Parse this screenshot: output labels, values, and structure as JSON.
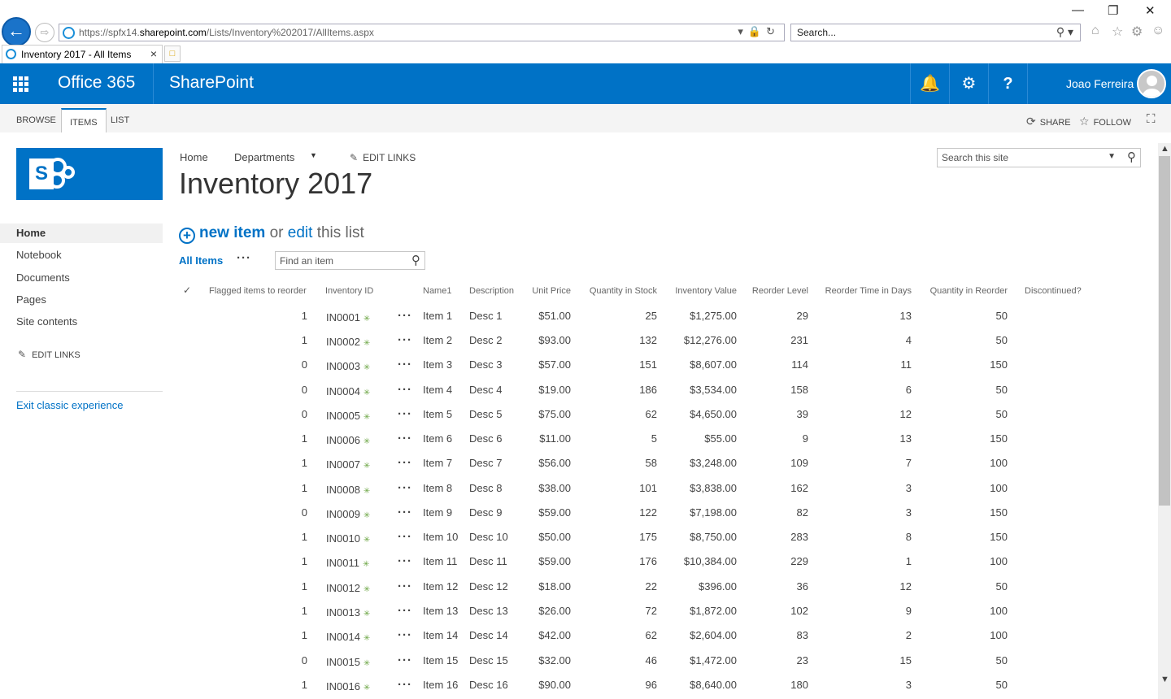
{
  "browser": {
    "url_prefix": "https://spfx14.",
    "url_domain": "sharepoint.com",
    "url_path": "/Lists/Inventory%202017/AllItems.aspx",
    "search_placeholder": "Search...",
    "tab_title": "Inventory 2017 - All Items"
  },
  "suite": {
    "brand": "Office 365",
    "app": "SharePoint",
    "user": "Joao Ferreira",
    "help": "?"
  },
  "ribbon": {
    "tabs": [
      "BROWSE",
      "ITEMS",
      "LIST"
    ],
    "share": "SHARE",
    "follow": "FOLLOW"
  },
  "nav": {
    "items": [
      "Home",
      "Notebook",
      "Documents",
      "Pages",
      "Site contents"
    ],
    "edit_links": "EDIT LINKS",
    "exit": "Exit classic experience"
  },
  "top": {
    "home": "Home",
    "departments": "Departments",
    "edit_links": "EDIT LINKS",
    "search_placeholder": "Search this site",
    "title": "Inventory 2017"
  },
  "toolbar": {
    "new_item": "new item",
    "or": "or",
    "edit": "edit",
    "this_list": "this list",
    "view": "All Items",
    "more": "···",
    "find_placeholder": "Find an item"
  },
  "table": {
    "headers": [
      "Flagged items to reorder",
      "Inventory ID",
      "Name1",
      "Description",
      "Unit Price",
      "Quantity in Stock",
      "Inventory Value",
      "Reorder Level",
      "Reorder Time in Days",
      "Quantity in Reorder",
      "Discontinued?"
    ],
    "rows": [
      [
        "1",
        "IN0001",
        "Item 1",
        "Desc 1",
        "$51.00",
        "25",
        "$1,275.00",
        "29",
        "13",
        "50"
      ],
      [
        "1",
        "IN0002",
        "Item 2",
        "Desc 2",
        "$93.00",
        "132",
        "$12,276.00",
        "231",
        "4",
        "50"
      ],
      [
        "0",
        "IN0003",
        "Item 3",
        "Desc 3",
        "$57.00",
        "151",
        "$8,607.00",
        "114",
        "11",
        "150"
      ],
      [
        "0",
        "IN0004",
        "Item 4",
        "Desc 4",
        "$19.00",
        "186",
        "$3,534.00",
        "158",
        "6",
        "50"
      ],
      [
        "0",
        "IN0005",
        "Item 5",
        "Desc 5",
        "$75.00",
        "62",
        "$4,650.00",
        "39",
        "12",
        "50"
      ],
      [
        "1",
        "IN0006",
        "Item 6",
        "Desc 6",
        "$11.00",
        "5",
        "$55.00",
        "9",
        "13",
        "150"
      ],
      [
        "1",
        "IN0007",
        "Item 7",
        "Desc 7",
        "$56.00",
        "58",
        "$3,248.00",
        "109",
        "7",
        "100"
      ],
      [
        "1",
        "IN0008",
        "Item 8",
        "Desc 8",
        "$38.00",
        "101",
        "$3,838.00",
        "162",
        "3",
        "100"
      ],
      [
        "0",
        "IN0009",
        "Item 9",
        "Desc 9",
        "$59.00",
        "122",
        "$7,198.00",
        "82",
        "3",
        "150"
      ],
      [
        "1",
        "IN0010",
        "Item 10",
        "Desc 10",
        "$50.00",
        "175",
        "$8,750.00",
        "283",
        "8",
        "150"
      ],
      [
        "1",
        "IN0011",
        "Item 11",
        "Desc 11",
        "$59.00",
        "176",
        "$10,384.00",
        "229",
        "1",
        "100"
      ],
      [
        "1",
        "IN0012",
        "Item 12",
        "Desc 12",
        "$18.00",
        "22",
        "$396.00",
        "36",
        "12",
        "50"
      ],
      [
        "1",
        "IN0013",
        "Item 13",
        "Desc 13",
        "$26.00",
        "72",
        "$1,872.00",
        "102",
        "9",
        "100"
      ],
      [
        "1",
        "IN0014",
        "Item 14",
        "Desc 14",
        "$42.00",
        "62",
        "$2,604.00",
        "83",
        "2",
        "100"
      ],
      [
        "0",
        "IN0015",
        "Item 15",
        "Desc 15",
        "$32.00",
        "46",
        "$1,472.00",
        "23",
        "15",
        "50"
      ],
      [
        "1",
        "IN0016",
        "Item 16",
        "Desc 16",
        "$90.00",
        "96",
        "$8,640.00",
        "180",
        "3",
        "50"
      ]
    ]
  },
  "colors": {
    "suite_blue": "#0072c6",
    "link_blue": "#0072c6",
    "new_badge_green": "#6ba543"
  }
}
